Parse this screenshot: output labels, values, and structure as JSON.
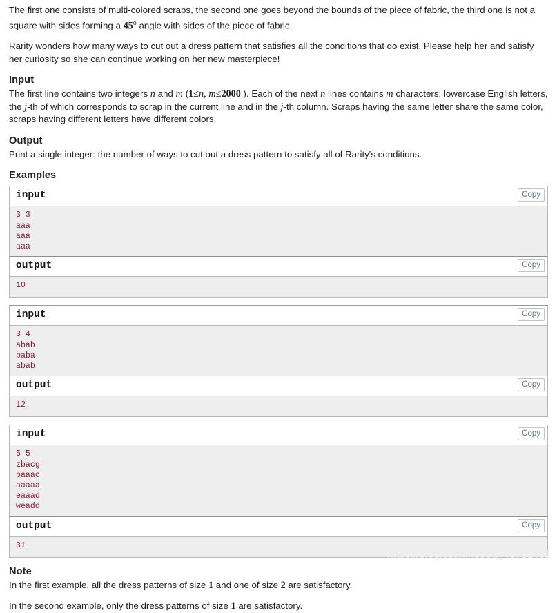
{
  "intro": {
    "paragraph1_part1": "The first one consists of multi-colored scraps, the second one goes beyond the bounds of the piece of fabric, the third one is not a square with sides forming a ",
    "angle_value": "45",
    "angle_degree": "o",
    "paragraph1_part2": " angle with sides of the piece of fabric.",
    "paragraph2": "Rarity wonders how many ways to cut out a dress pattern that satisfies all the conditions that do exist. Please help her and satisfy her curiosity so she can continue working on her new masterpiece!"
  },
  "input_section": {
    "title": "Input",
    "t1": "The first line contains two integers ",
    "var_n": "n",
    "t2": " and ",
    "var_m": "m",
    "t3": " (",
    "num_1": "1",
    "le1": "≤",
    "var_n2": "n",
    "comma": ", ",
    "var_m2": "m",
    "le2": "≤",
    "num_2000": "2000",
    "t4": " ). Each of the next ",
    "var_n3": "n",
    "t5": " lines contains ",
    "var_m3": "m",
    "t6": " characters: lowercase English letters, the ",
    "var_j": "j",
    "t7": "-th of which corresponds to scrap in the current line and in the ",
    "var_j2": "j",
    "t8": "-th column. Scraps having the same letter share the same color, scraps having different letters have different colors."
  },
  "output_section": {
    "title": "Output",
    "text": "Print a single integer: the number of ways to cut out a dress pattern to satisfy all of Rarity's conditions."
  },
  "examples": {
    "heading": "Examples",
    "copy_label": "Copy",
    "input_label": "input",
    "output_label": "output",
    "blocks": [
      {
        "input": "3 3\naaa\naaa\naaa",
        "output": "10"
      },
      {
        "input": "3 4\nabab\nbaba\nabab",
        "output": "12"
      },
      {
        "input": "5 5\nzbacg\nbaaac\naaaaa\neaaad\nweadd",
        "output": "31"
      }
    ]
  },
  "note_section": {
    "title": "Note",
    "p1_a": "In the first example, all the dress patterns of size ",
    "p1_n1": "1",
    "p1_b": " and one of size ",
    "p1_n2": "2",
    "p1_c": " are satisfactory.",
    "p2_a": "In the second example, only the dress patterns of size ",
    "p2_n1": "1",
    "p2_b": " are satisfactory."
  },
  "watermark": {
    "text": "https://blog.csdn.net/qq_43781431"
  }
}
